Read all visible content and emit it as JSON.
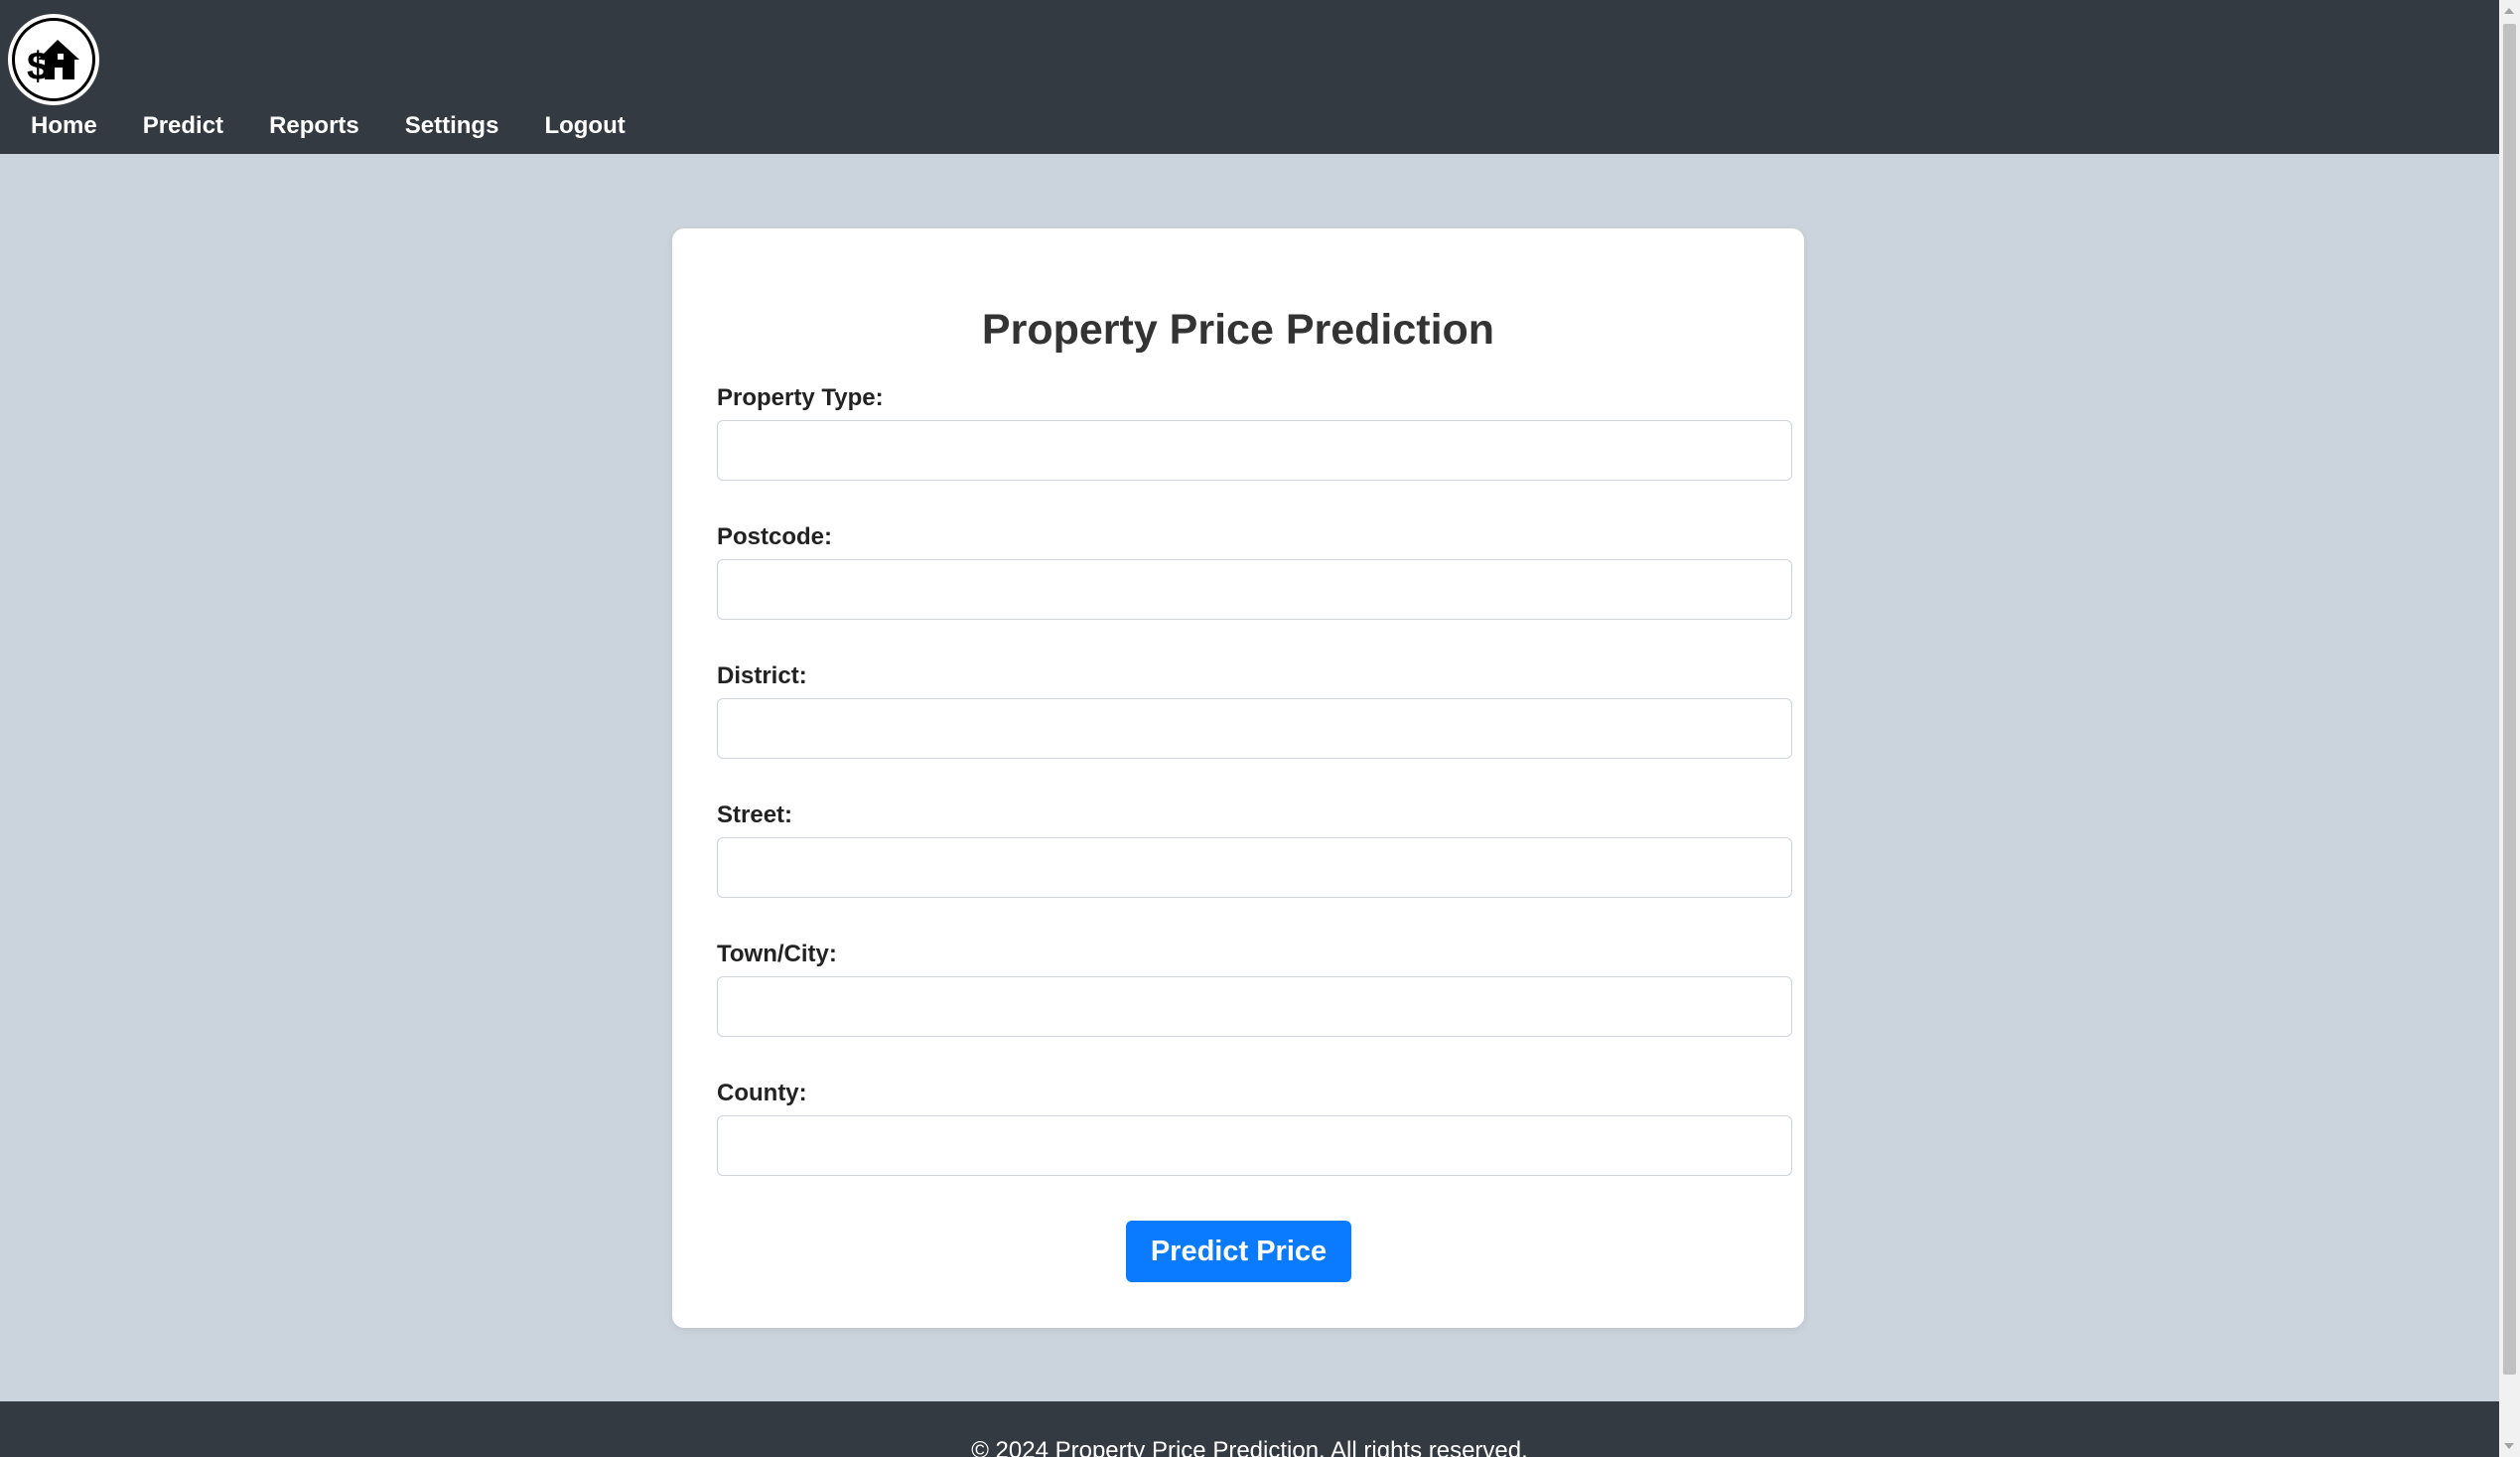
{
  "header": {
    "logo_icon": "house-dollar-icon",
    "nav": [
      {
        "label": "Home"
      },
      {
        "label": "Predict"
      },
      {
        "label": "Reports"
      },
      {
        "label": "Settings"
      },
      {
        "label": "Logout"
      }
    ]
  },
  "form": {
    "title": "Property Price Prediction",
    "fields": [
      {
        "label": "Property Type:",
        "value": ""
      },
      {
        "label": "Postcode:",
        "value": ""
      },
      {
        "label": "District:",
        "value": ""
      },
      {
        "label": "Street:",
        "value": ""
      },
      {
        "label": "Town/City:",
        "value": ""
      },
      {
        "label": "County:",
        "value": ""
      }
    ],
    "submit_label": "Predict Price"
  },
  "footer": {
    "text": "© 2024 Property Price Prediction. All rights reserved."
  },
  "colors": {
    "header_bg": "#343a42",
    "page_bg": "#cbd3dc",
    "accent": "#0a7bff"
  }
}
